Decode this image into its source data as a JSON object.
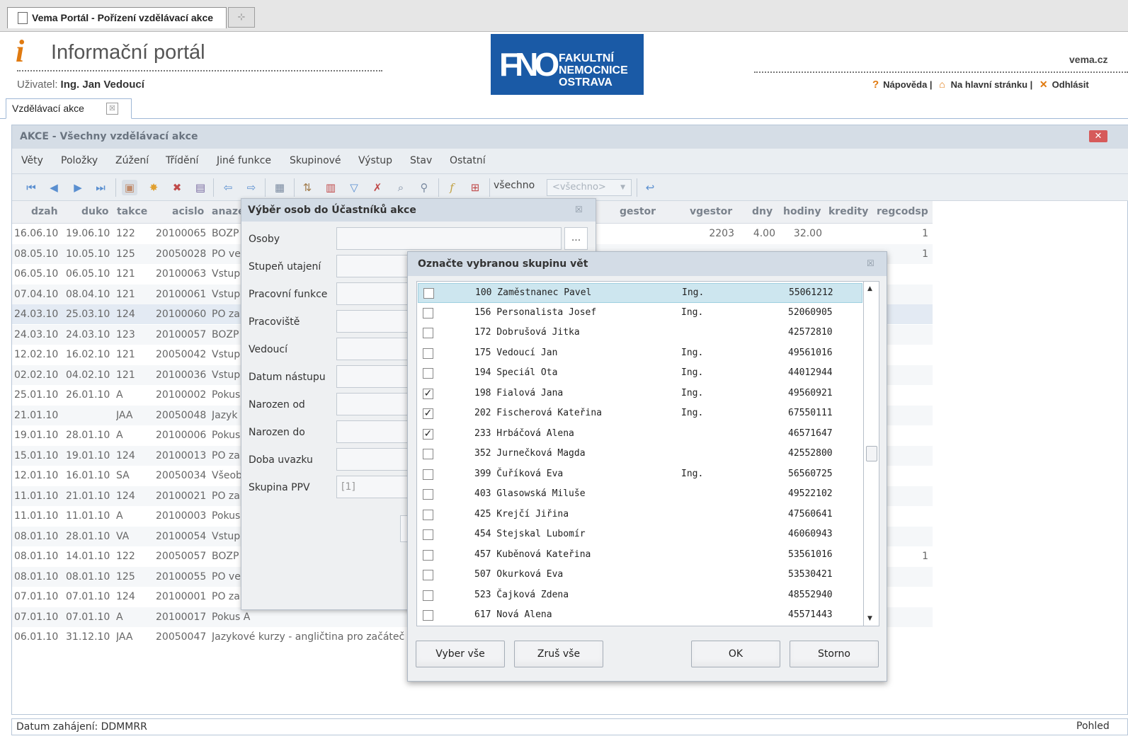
{
  "browser": {
    "tab_title": "Vema Portál - Pořízení vzdělávací akce",
    "newtab": "⊹"
  },
  "header": {
    "title": "Informační portál",
    "user_label": "Uživatel:",
    "user_name": "Ing. Jan Vedoucí",
    "logo_mono": "FNO",
    "logo_line1": "FAKULTNÍ",
    "logo_line2": "NEMOCNICE",
    "logo_line3": "OSTRAVA",
    "site": "vema.cz",
    "help": "Nápověda",
    "home": "Na hlavní stránku",
    "logout": "Odhlásit",
    "accent": "#e07a10"
  },
  "apptab": {
    "label": "Vzdělávací akce",
    "close": "☒"
  },
  "window": {
    "title": "AKCE - Všechny vzdělávací akce",
    "close": "✕",
    "menu": [
      "Věty",
      "Položky",
      "Zúžení",
      "Třídění",
      "Jiné funkce",
      "Skupinové",
      "Výstup",
      "Stav",
      "Ostatní"
    ],
    "filter_label": "všechno",
    "filter_select": "<všechno>",
    "status": "Datum zahájení: DDMMRR",
    "status_right": "Pohled"
  },
  "grid": {
    "headers": [
      "dzah",
      "duko",
      "takce",
      "acislo",
      "anazev",
      "gestor",
      "vgestor",
      "dny",
      "hodiny",
      "kredity",
      "regcodsp"
    ],
    "rows": [
      {
        "dzah": "16.06.10",
        "duko": "19.06.10",
        "takce": "122",
        "acislo": "20100065",
        "anazev": "BOZP",
        "gestor": "",
        "vgestor": "2203",
        "dny": "4.00",
        "hodiny": "32.00",
        "kredity": "",
        "regcodsp": "1"
      },
      {
        "dzah": "08.05.10",
        "duko": "10.05.10",
        "takce": "125",
        "acislo": "20050028",
        "anazev": "PO ve",
        "gestor": "",
        "vgestor": "",
        "dny": "",
        "hodiny": "",
        "kredity": "",
        "regcodsp": "1"
      },
      {
        "dzah": "06.05.10",
        "duko": "06.05.10",
        "takce": "121",
        "acislo": "20100063",
        "anazev": "Vstup",
        "gestor": "",
        "vgestor": "",
        "dny": "",
        "hodiny": "",
        "kredity": "",
        "regcodsp": ""
      },
      {
        "dzah": "07.04.10",
        "duko": "08.04.10",
        "takce": "121",
        "acislo": "20100061",
        "anazev": "Vstup",
        "gestor": "",
        "vgestor": "",
        "dny": "",
        "hodiny": "",
        "kredity": "",
        "regcodsp": ""
      },
      {
        "dzah": "24.03.10",
        "duko": "25.03.10",
        "takce": "124",
        "acislo": "20100060",
        "anazev": "PO za",
        "gestor": "",
        "vgestor": "",
        "dny": "",
        "hodiny": "",
        "kredity": "",
        "regcodsp": ""
      },
      {
        "dzah": "24.03.10",
        "duko": "24.03.10",
        "takce": "123",
        "acislo": "20100057",
        "anazev": "BOZP",
        "gestor": "",
        "vgestor": "",
        "dny": "",
        "hodiny": "",
        "kredity": "",
        "regcodsp": ""
      },
      {
        "dzah": "12.02.10",
        "duko": "16.02.10",
        "takce": "121",
        "acislo": "20050042",
        "anazev": "Vstup",
        "gestor": "",
        "vgestor": "",
        "dny": "",
        "hodiny": "",
        "kredity": "",
        "regcodsp": ""
      },
      {
        "dzah": "02.02.10",
        "duko": "04.02.10",
        "takce": "121",
        "acislo": "20100036",
        "anazev": "Vstup",
        "gestor": "",
        "vgestor": "",
        "dny": "",
        "hodiny": "",
        "kredity": "",
        "regcodsp": ""
      },
      {
        "dzah": "25.01.10",
        "duko": "26.01.10",
        "takce": "A",
        "acislo": "20100002",
        "anazev": "Pokus",
        "gestor": "",
        "vgestor": "",
        "dny": "",
        "hodiny": "",
        "kredity": "",
        "regcodsp": ""
      },
      {
        "dzah": "21.01.10",
        "duko": "",
        "takce": "JAA",
        "acislo": "20050048",
        "anazev": "Jazyk",
        "gestor": "",
        "vgestor": "",
        "dny": "",
        "hodiny": "",
        "kredity": "",
        "regcodsp": ""
      },
      {
        "dzah": "19.01.10",
        "duko": "28.01.10",
        "takce": "A",
        "acislo": "20100006",
        "anazev": "Pokus",
        "gestor": "",
        "vgestor": "",
        "dny": "",
        "hodiny": "",
        "kredity": "",
        "regcodsp": ""
      },
      {
        "dzah": "15.01.10",
        "duko": "19.01.10",
        "takce": "124",
        "acislo": "20100013",
        "anazev": "PO za",
        "gestor": "",
        "vgestor": "",
        "dny": "",
        "hodiny": "",
        "kredity": "",
        "regcodsp": ""
      },
      {
        "dzah": "12.01.10",
        "duko": "16.01.10",
        "takce": "SA",
        "acislo": "20050034",
        "anazev": "Všeob",
        "gestor": "",
        "vgestor": "",
        "dny": "",
        "hodiny": "",
        "kredity": "",
        "regcodsp": ""
      },
      {
        "dzah": "11.01.10",
        "duko": "21.01.10",
        "takce": "124",
        "acislo": "20100021",
        "anazev": "PO za",
        "gestor": "",
        "vgestor": "",
        "dny": "",
        "hodiny": "",
        "kredity": "",
        "regcodsp": ""
      },
      {
        "dzah": "11.01.10",
        "duko": "11.01.10",
        "takce": "A",
        "acislo": "20100003",
        "anazev": "Pokus",
        "gestor": "",
        "vgestor": "",
        "dny": "",
        "hodiny": "",
        "kredity": "",
        "regcodsp": ""
      },
      {
        "dzah": "08.01.10",
        "duko": "28.01.10",
        "takce": "VA",
        "acislo": "20100054",
        "anazev": "Vstup",
        "gestor": "",
        "vgestor": "",
        "dny": "",
        "hodiny": "",
        "kredity": "",
        "regcodsp": ""
      },
      {
        "dzah": "08.01.10",
        "duko": "14.01.10",
        "takce": "122",
        "acislo": "20050057",
        "anazev": "BOZP",
        "gestor": "",
        "vgestor": "",
        "dny": "",
        "hodiny": "",
        "kredity": "",
        "regcodsp": "1"
      },
      {
        "dzah": "08.01.10",
        "duko": "08.01.10",
        "takce": "125",
        "acislo": "20100055",
        "anazev": "PO ve",
        "gestor": "",
        "vgestor": "",
        "dny": "",
        "hodiny": "",
        "kredity": "",
        "regcodsp": ""
      },
      {
        "dzah": "07.01.10",
        "duko": "07.01.10",
        "takce": "124",
        "acislo": "20100001",
        "anazev": "PO za",
        "gestor": "",
        "vgestor": "",
        "dny": "",
        "hodiny": "",
        "kredity": "",
        "regcodsp": ""
      },
      {
        "dzah": "07.01.10",
        "duko": "07.01.10",
        "takce": "A",
        "acislo": "20100017",
        "anazev": "Pokus A",
        "gestor": "",
        "vgestor": "",
        "dny": "",
        "hodiny": "",
        "kredity": "",
        "regcodsp": ""
      },
      {
        "dzah": "06.01.10",
        "duko": "31.12.10",
        "takce": "JAA",
        "acislo": "20050047",
        "anazev": "Jazykové kurzy - angličtina pro začáteč",
        "gestor": "",
        "vgestor": "",
        "dny": "",
        "hodiny": "",
        "kredity": "",
        "regcodsp": ""
      }
    ]
  },
  "dialog1": {
    "title": "Výběr osob do Účastníků akce",
    "close": "☒",
    "fields": [
      {
        "label": "Osoby",
        "value": ""
      },
      {
        "label": "Stupeň utajení",
        "value": ""
      },
      {
        "label": "Pracovní funkce",
        "value": ""
      },
      {
        "label": "Pracoviště",
        "value": ""
      },
      {
        "label": "Vedoucí",
        "value": ""
      },
      {
        "label": "Datum nástupu",
        "value": ""
      },
      {
        "label": "Narozen od",
        "value": ""
      },
      {
        "label": "Narozen do",
        "value": ""
      },
      {
        "label": "Doba uvazku",
        "value": ""
      },
      {
        "label": "Skupina PPV",
        "value": "[1]"
      }
    ],
    "browse": "..."
  },
  "dialog2": {
    "title": "Označte vybranou skupinu vět",
    "close": "☒",
    "items": [
      {
        "num": "100",
        "name": "Zaměstnanec Pavel",
        "titul": "Ing.",
        "code": "55061212",
        "checked": false,
        "highlight": true
      },
      {
        "num": "156",
        "name": "Personalista Josef",
        "titul": "Ing.",
        "code": "52060905",
        "checked": false
      },
      {
        "num": "172",
        "name": "Dobrušová Jitka",
        "titul": "",
        "code": "42572810",
        "checked": false
      },
      {
        "num": "175",
        "name": "Vedoucí Jan",
        "titul": "Ing.",
        "code": "49561016",
        "checked": false
      },
      {
        "num": "194",
        "name": "Speciál Ota",
        "titul": "Ing.",
        "code": "44012944",
        "checked": false
      },
      {
        "num": "198",
        "name": "Fialová Jana",
        "titul": "Ing.",
        "code": "49560921",
        "checked": true
      },
      {
        "num": "202",
        "name": "Fischerová Kateřina",
        "titul": "Ing.",
        "code": "67550111",
        "checked": true
      },
      {
        "num": "233",
        "name": "Hrbáčová Alena",
        "titul": "",
        "code": "46571647",
        "checked": true
      },
      {
        "num": "352",
        "name": "Jurnečková Magda",
        "titul": "",
        "code": "42552800",
        "checked": false
      },
      {
        "num": "399",
        "name": "Čuříková Eva",
        "titul": "Ing.",
        "code": "56560725",
        "checked": false
      },
      {
        "num": "403",
        "name": "Glasowská Miluše",
        "titul": "",
        "code": "49522102",
        "checked": false
      },
      {
        "num": "425",
        "name": "Krejčí Jiřina",
        "titul": "",
        "code": "47560641",
        "checked": false
      },
      {
        "num": "454",
        "name": "Stejskal Lubomír",
        "titul": "",
        "code": "46060943",
        "checked": false
      },
      {
        "num": "457",
        "name": "Kuběnová Kateřina",
        "titul": "",
        "code": "53561016",
        "checked": false
      },
      {
        "num": "507",
        "name": "Okurková Eva",
        "titul": "",
        "code": "53530421",
        "checked": false
      },
      {
        "num": "523",
        "name": "Čajková Zdena",
        "titul": "",
        "code": "48552940",
        "checked": false
      },
      {
        "num": "617",
        "name": "Nová Alena",
        "titul": "",
        "code": "45571443",
        "checked": false
      }
    ],
    "buttons": {
      "select_all": "Vyber vše",
      "clear_all": "Zruš vše",
      "ok": "OK",
      "cancel": "Storno"
    }
  }
}
